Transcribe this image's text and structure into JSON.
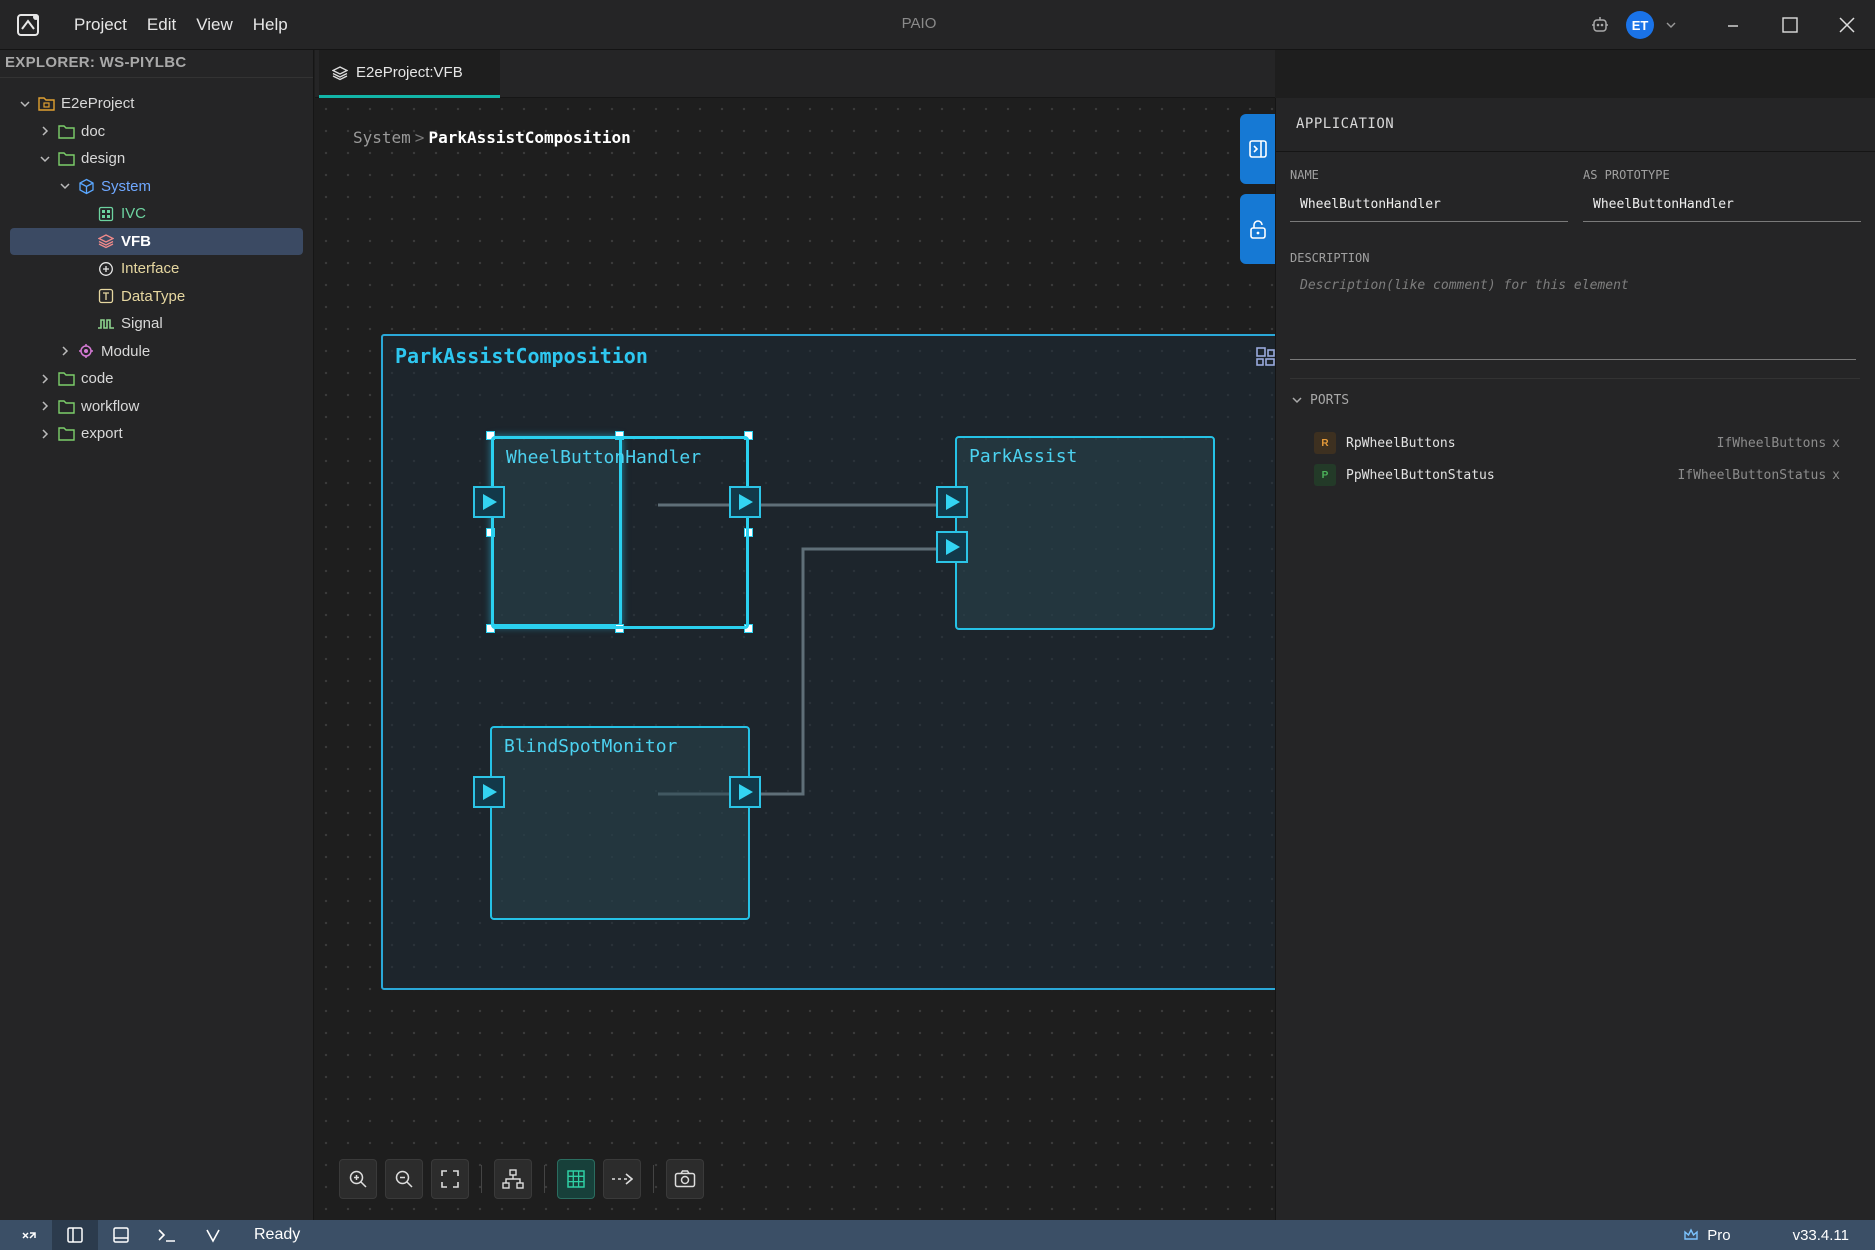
{
  "window": {
    "title": "PAIO",
    "menu": [
      "Project",
      "Edit",
      "View",
      "Help"
    ],
    "user_initials": "ET"
  },
  "explorer": {
    "header": "EXPLORER: WS-PIYLBC",
    "tree": [
      {
        "label": "E2eProject",
        "level": 0,
        "expanded": true,
        "icon": "project-icon"
      },
      {
        "label": "doc",
        "level": 1,
        "expanded": false,
        "icon": "folder-icon"
      },
      {
        "label": "design",
        "level": 1,
        "expanded": true,
        "icon": "folder-icon"
      },
      {
        "label": "System",
        "level": 2,
        "expanded": true,
        "icon": "cube-icon"
      },
      {
        "label": "IVC",
        "level": 3,
        "icon": "grid-icon"
      },
      {
        "label": "VFB",
        "level": 3,
        "icon": "layers-icon",
        "selected": true
      },
      {
        "label": "Interface",
        "level": 3,
        "icon": "interface-icon"
      },
      {
        "label": "DataType",
        "level": 3,
        "icon": "datatype-icon"
      },
      {
        "label": "Signal",
        "level": 3,
        "icon": "signal-icon"
      },
      {
        "label": "Module",
        "level": 2,
        "expanded": false,
        "icon": "module-icon"
      },
      {
        "label": "code",
        "level": 1,
        "expanded": false,
        "icon": "folder-icon"
      },
      {
        "label": "workflow",
        "level": 1,
        "expanded": false,
        "icon": "folder-icon"
      },
      {
        "label": "export",
        "level": 1,
        "expanded": false,
        "icon": "folder-icon"
      }
    ]
  },
  "editor": {
    "tab_label": "E2eProject:VFB",
    "breadcrumb": {
      "parent": "System",
      "separator": ">",
      "current": "ParkAssistComposition"
    },
    "composition": {
      "name": "ParkAssistComposition",
      "components": [
        {
          "name": "WheelButtonHandler",
          "selected": true
        },
        {
          "name": "ParkAssist",
          "selected": false
        },
        {
          "name": "BlindSpotMonitor",
          "selected": false
        }
      ]
    },
    "toolbar": [
      "zoom-in-icon",
      "zoom-out-icon",
      "fit-view-icon",
      "auto-layout-icon",
      "grid-toggle-icon",
      "connector-style-icon",
      "screenshot-icon"
    ]
  },
  "properties": {
    "header": "APPLICATION",
    "name_label": "NAME",
    "name_value": "WheelButtonHandler",
    "prototype_label": "AS PROTOTYPE",
    "prototype_value": "WheelButtonHandler",
    "description_label": "DESCRIPTION",
    "description_placeholder": "Description(like comment) for this element",
    "ports_label": "PORTS",
    "ports": [
      {
        "badge": "R",
        "kind": "require",
        "name": "RpWheelButtons",
        "interface": "IfWheelButtons",
        "remove": "x"
      },
      {
        "badge": "P",
        "kind": "provide",
        "name": "PpWheelButtonStatus",
        "interface": "IfWheelButtonStatus",
        "remove": "x"
      }
    ]
  },
  "statusbar": {
    "status": "Ready",
    "edition": "Pro",
    "version": "v33.4.11"
  },
  "colors": {
    "accent": "#12b5a8",
    "component_border": "#25c2e6",
    "side_tab": "#1679d4",
    "statusbar": "#3b4f66"
  }
}
